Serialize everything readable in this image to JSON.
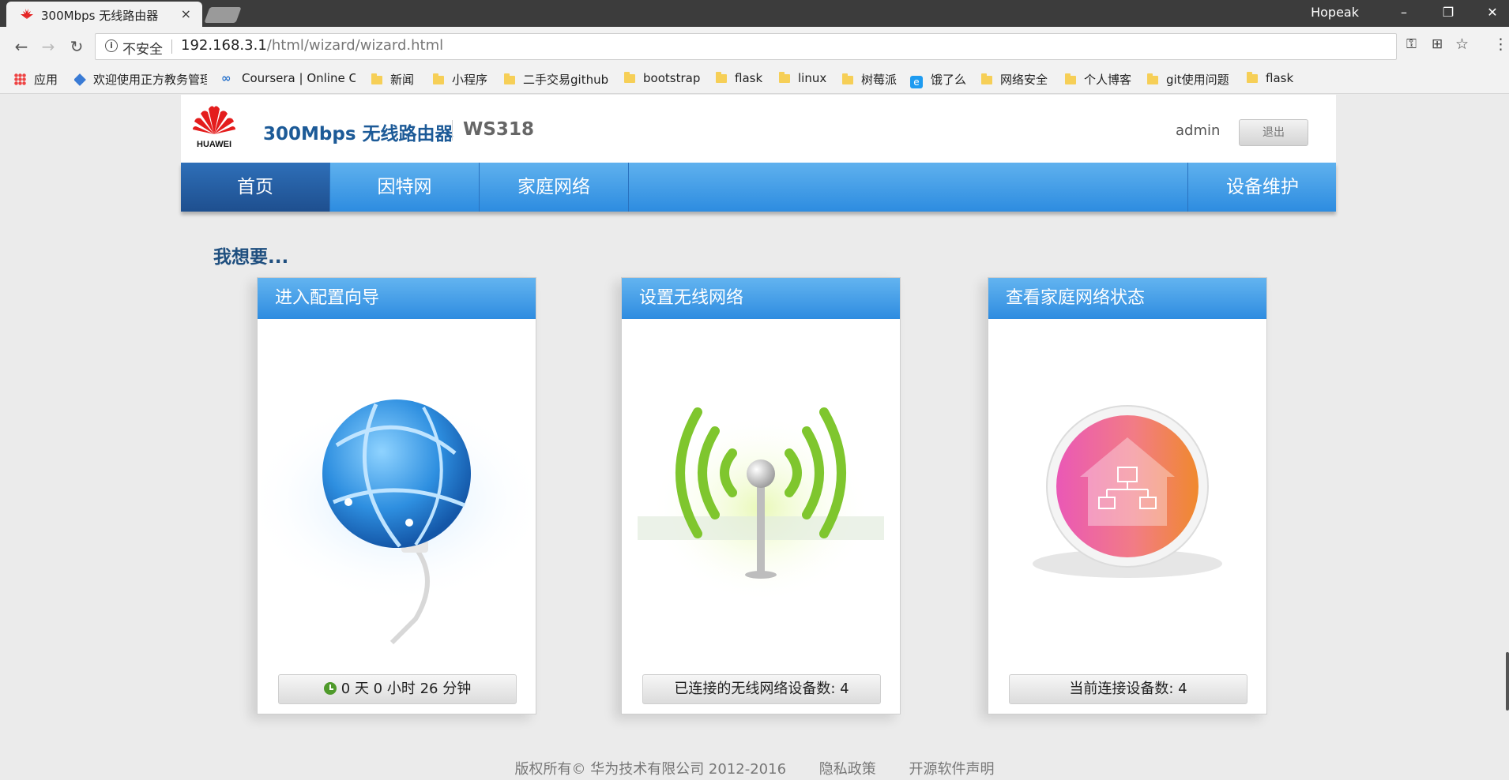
{
  "browser": {
    "tab_title": "300Mbps 无线路由器",
    "tab_close": "×",
    "profile_name": "Hopeak",
    "window_controls": [
      "–",
      "❐",
      "✕"
    ],
    "address": {
      "security_label": "不安全",
      "host": "192.168.3.1",
      "path": "/html/wizard/wizard.html"
    },
    "bookmarks": [
      {
        "label": "应用",
        "icon": "apps-grid-icon"
      },
      {
        "label": "欢迎使用正方教务管理",
        "icon": "site-icon"
      },
      {
        "label": "Coursera | Online C",
        "icon": "coursera-icon"
      },
      {
        "label": "新闻",
        "icon": "folder-icon"
      },
      {
        "label": "小程序",
        "icon": "folder-icon"
      },
      {
        "label": "二手交易github",
        "icon": "folder-icon"
      },
      {
        "label": "bootstrap",
        "icon": "folder-icon"
      },
      {
        "label": "flask",
        "icon": "folder-icon"
      },
      {
        "label": "linux",
        "icon": "folder-icon"
      },
      {
        "label": "树莓派",
        "icon": "folder-icon"
      },
      {
        "label": "饿了么",
        "icon": "eleme-icon"
      },
      {
        "label": "网络安全",
        "icon": "folder-icon"
      },
      {
        "label": "个人博客",
        "icon": "folder-icon"
      },
      {
        "label": "git使用问题",
        "icon": "folder-icon"
      },
      {
        "label": "flask",
        "icon": "folder-icon"
      }
    ]
  },
  "router": {
    "brand": "HUAWEI",
    "product_name": "300Mbps 无线路由器",
    "model": "WS318",
    "user": "admin",
    "logout_label": "退出",
    "nav": [
      {
        "label": "首页",
        "active": true
      },
      {
        "label": "因特网",
        "active": false
      },
      {
        "label": "家庭网络",
        "active": false
      },
      {
        "label": "设备维护",
        "active": false
      }
    ],
    "section_title": "我想要...",
    "cards": [
      {
        "title": "进入配置向导",
        "status": "0 天 0 小时 26 分钟",
        "icon": "globe-icon"
      },
      {
        "title": "设置无线网络",
        "status": "已连接的无线网络设备数: 4",
        "icon": "wifi-antenna-icon"
      },
      {
        "title": "查看家庭网络状态",
        "status": "当前连接设备数:  4",
        "icon": "home-network-icon"
      }
    ],
    "footer": {
      "copyright": "版权所有© 华为技术有限公司 2012-2016",
      "privacy": "隐私政策",
      "open_source": "开源软件声明"
    }
  },
  "colors": {
    "accent_blue": "#2d8ce0",
    "nav_active": "#1e4f8f",
    "brand_red": "#e41d1d"
  }
}
